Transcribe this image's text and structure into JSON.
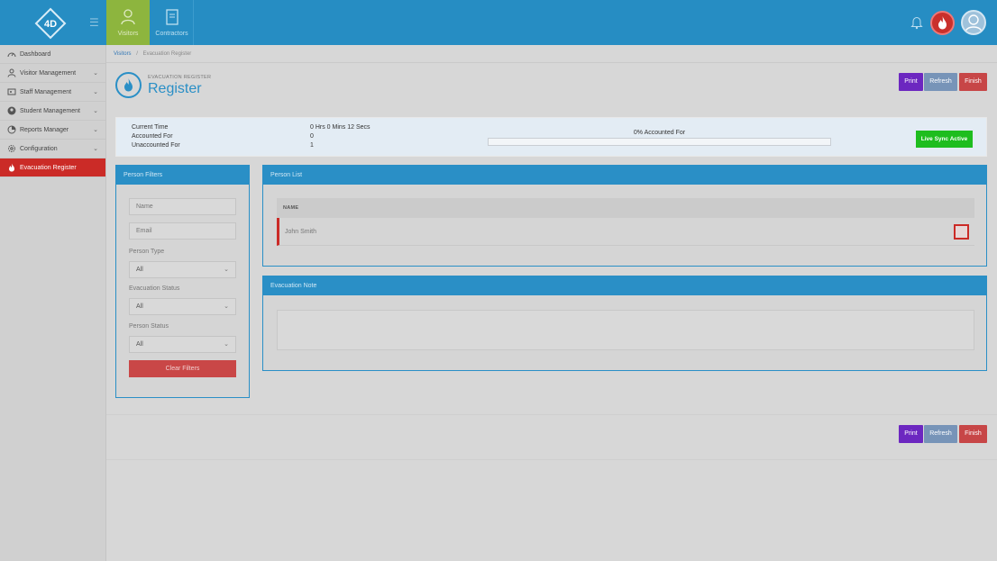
{
  "topbar": {
    "nav": [
      {
        "label": "Visitors",
        "icon": "user-icon",
        "active": true
      },
      {
        "label": "Contractors",
        "icon": "document-icon",
        "active": false
      }
    ],
    "colors": {
      "bar": "#268dc3",
      "active_tab": "#8db53e"
    }
  },
  "sidebar": {
    "items": [
      {
        "label": "Dashboard",
        "icon": "dashboard-icon",
        "has_chevron": false
      },
      {
        "label": "Visitor Management",
        "icon": "user-icon",
        "has_chevron": true
      },
      {
        "label": "Staff Management",
        "icon": "staff-icon",
        "has_chevron": true
      },
      {
        "label": "Student Management",
        "icon": "student-icon",
        "has_chevron": true
      },
      {
        "label": "Reports Manager",
        "icon": "reports-icon",
        "has_chevron": true
      },
      {
        "label": "Configuration",
        "icon": "gear-icon",
        "has_chevron": true
      },
      {
        "label": "Evacuation Register",
        "icon": "flame-icon",
        "has_chevron": false,
        "active": true
      }
    ]
  },
  "breadcrumb": {
    "root": "Visitors",
    "separator": "/",
    "current": "Evacuation Register"
  },
  "header": {
    "subtitle": "EVACUATION REGISTER",
    "title": "Register"
  },
  "actions": {
    "print": "Print",
    "refresh": "Refresh",
    "finish": "Finish"
  },
  "stats": {
    "current_time_label": "Current Time",
    "current_time_value": "0 Hrs 0 Mins 12 Secs",
    "accounted_label": "Accounted For",
    "accounted_value": "0",
    "unaccounted_label": "Unaccounted For",
    "unaccounted_value": "1",
    "progress_label": "0% Accounted For",
    "progress_fraction": 0,
    "live_sync": "Live Sync Active"
  },
  "filters": {
    "title": "Person Filters",
    "name_placeholder": "Name",
    "email_placeholder": "Email",
    "person_type_label": "Person Type",
    "person_type_value": "All",
    "evac_status_label": "Evacuation Status",
    "evac_status_value": "All",
    "person_status_label": "Person Status",
    "person_status_value": "All",
    "clear": "Clear Filters"
  },
  "person_list": {
    "title": "Person List",
    "column": "NAME",
    "rows": [
      {
        "name": "John Smith"
      }
    ]
  },
  "evac_note": {
    "title": "Evacuation Note"
  }
}
